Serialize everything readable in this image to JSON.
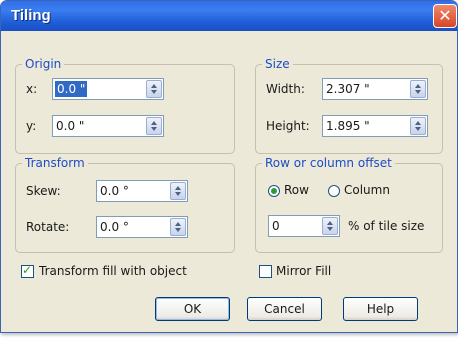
{
  "dialog": {
    "title": "Tiling",
    "close_glyph": "✕"
  },
  "origin": {
    "legend": "Origin",
    "x_label": "x:",
    "x_value": "0.0 \"",
    "y_label": "y:",
    "y_value": "0.0 \""
  },
  "size": {
    "legend": "Size",
    "width_label": "Width:",
    "width_value": "2.307 \"",
    "height_label": "Height:",
    "height_value": "1.895 \""
  },
  "transform": {
    "legend": "Transform",
    "skew_label": "Skew:",
    "skew_value": "0.0 °",
    "rotate_label": "Rotate:",
    "rotate_value": "0.0 °"
  },
  "offset": {
    "legend": "Row or column offset",
    "row_label": "Row",
    "column_label": "Column",
    "selected": "Row",
    "amount_value": "0",
    "amount_suffix": "% of tile size"
  },
  "options": {
    "transform_fill_label": "Transform fill with object",
    "transform_fill_checked": true,
    "mirror_fill_label": "Mirror Fill",
    "mirror_fill_checked": false
  },
  "buttons": {
    "ok": "OK",
    "cancel": "Cancel",
    "help": "Help"
  },
  "colors": {
    "title_bar": "#2f6ee8",
    "group_legend": "#1c4cc8",
    "dialog_bg": "#ece9d8",
    "close_button": "#d8442a"
  }
}
